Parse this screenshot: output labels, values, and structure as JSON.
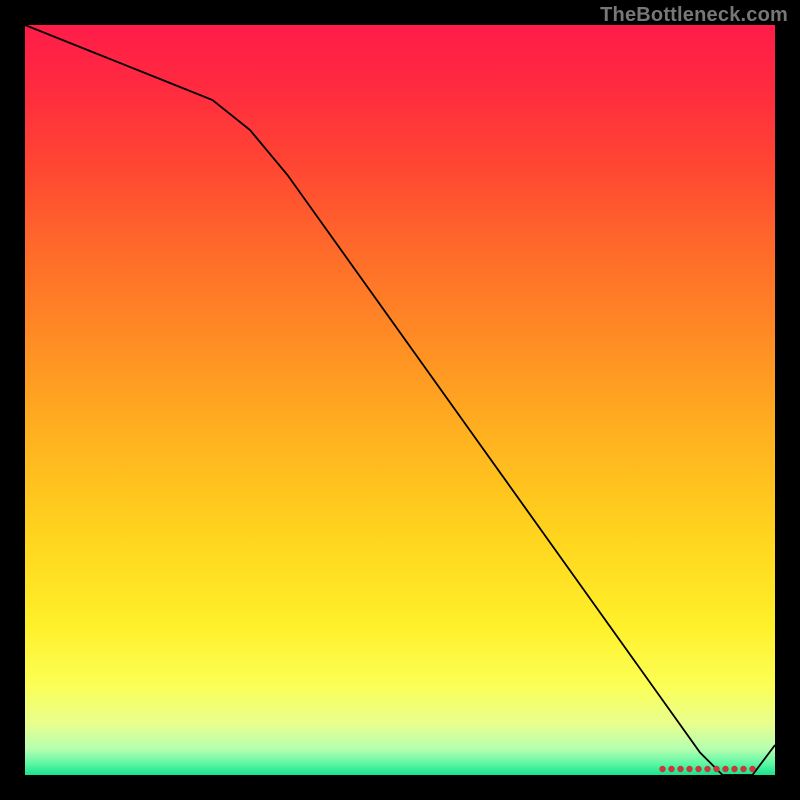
{
  "watermark": "TheBottleneck.com",
  "chart_data": {
    "type": "line",
    "title": "",
    "xlabel": "",
    "ylabel": "",
    "xlim": [
      0,
      100
    ],
    "ylim": [
      0,
      100
    ],
    "x": [
      0,
      5,
      10,
      15,
      20,
      25,
      30,
      35,
      40,
      45,
      50,
      55,
      60,
      65,
      70,
      75,
      80,
      85,
      90,
      93,
      97,
      100
    ],
    "values": [
      100,
      98,
      96,
      94,
      92,
      90,
      86,
      80,
      73,
      66,
      59,
      52,
      45,
      38,
      31,
      24,
      17,
      10,
      3,
      0,
      0,
      4
    ],
    "series": [
      {
        "name": "bottleneck-line",
        "stroke": "#000000",
        "width": 1.8,
        "x": [
          0,
          5,
          10,
          15,
          20,
          25,
          30,
          35,
          40,
          45,
          50,
          55,
          60,
          65,
          70,
          75,
          80,
          85,
          90,
          93,
          97,
          100
        ],
        "values": [
          100,
          98,
          96,
          94,
          92,
          90,
          86,
          80,
          73,
          66,
          59,
          52,
          45,
          38,
          31,
          24,
          17,
          10,
          3,
          0,
          0,
          4
        ]
      }
    ],
    "markers": {
      "y": 0.8,
      "x": [
        85,
        86.2,
        87.4,
        88.6,
        89.8,
        91,
        92.2,
        93.4,
        94.6,
        95.8,
        97
      ],
      "color": "#c53a3a",
      "radius": 3.2
    },
    "gradient_stops": [
      {
        "offset": 0.0,
        "color": "#ff1c49"
      },
      {
        "offset": 0.08,
        "color": "#ff2a40"
      },
      {
        "offset": 0.18,
        "color": "#ff4433"
      },
      {
        "offset": 0.3,
        "color": "#ff6a2a"
      },
      {
        "offset": 0.42,
        "color": "#ff8c24"
      },
      {
        "offset": 0.55,
        "color": "#ffb21f"
      },
      {
        "offset": 0.68,
        "color": "#ffd41e"
      },
      {
        "offset": 0.8,
        "color": "#fff02a"
      },
      {
        "offset": 0.88,
        "color": "#fbff55"
      },
      {
        "offset": 0.93,
        "color": "#eaff8c"
      },
      {
        "offset": 0.965,
        "color": "#b6ffb0"
      },
      {
        "offset": 0.985,
        "color": "#5cf7a3"
      },
      {
        "offset": 1.0,
        "color": "#18e28d"
      }
    ]
  }
}
